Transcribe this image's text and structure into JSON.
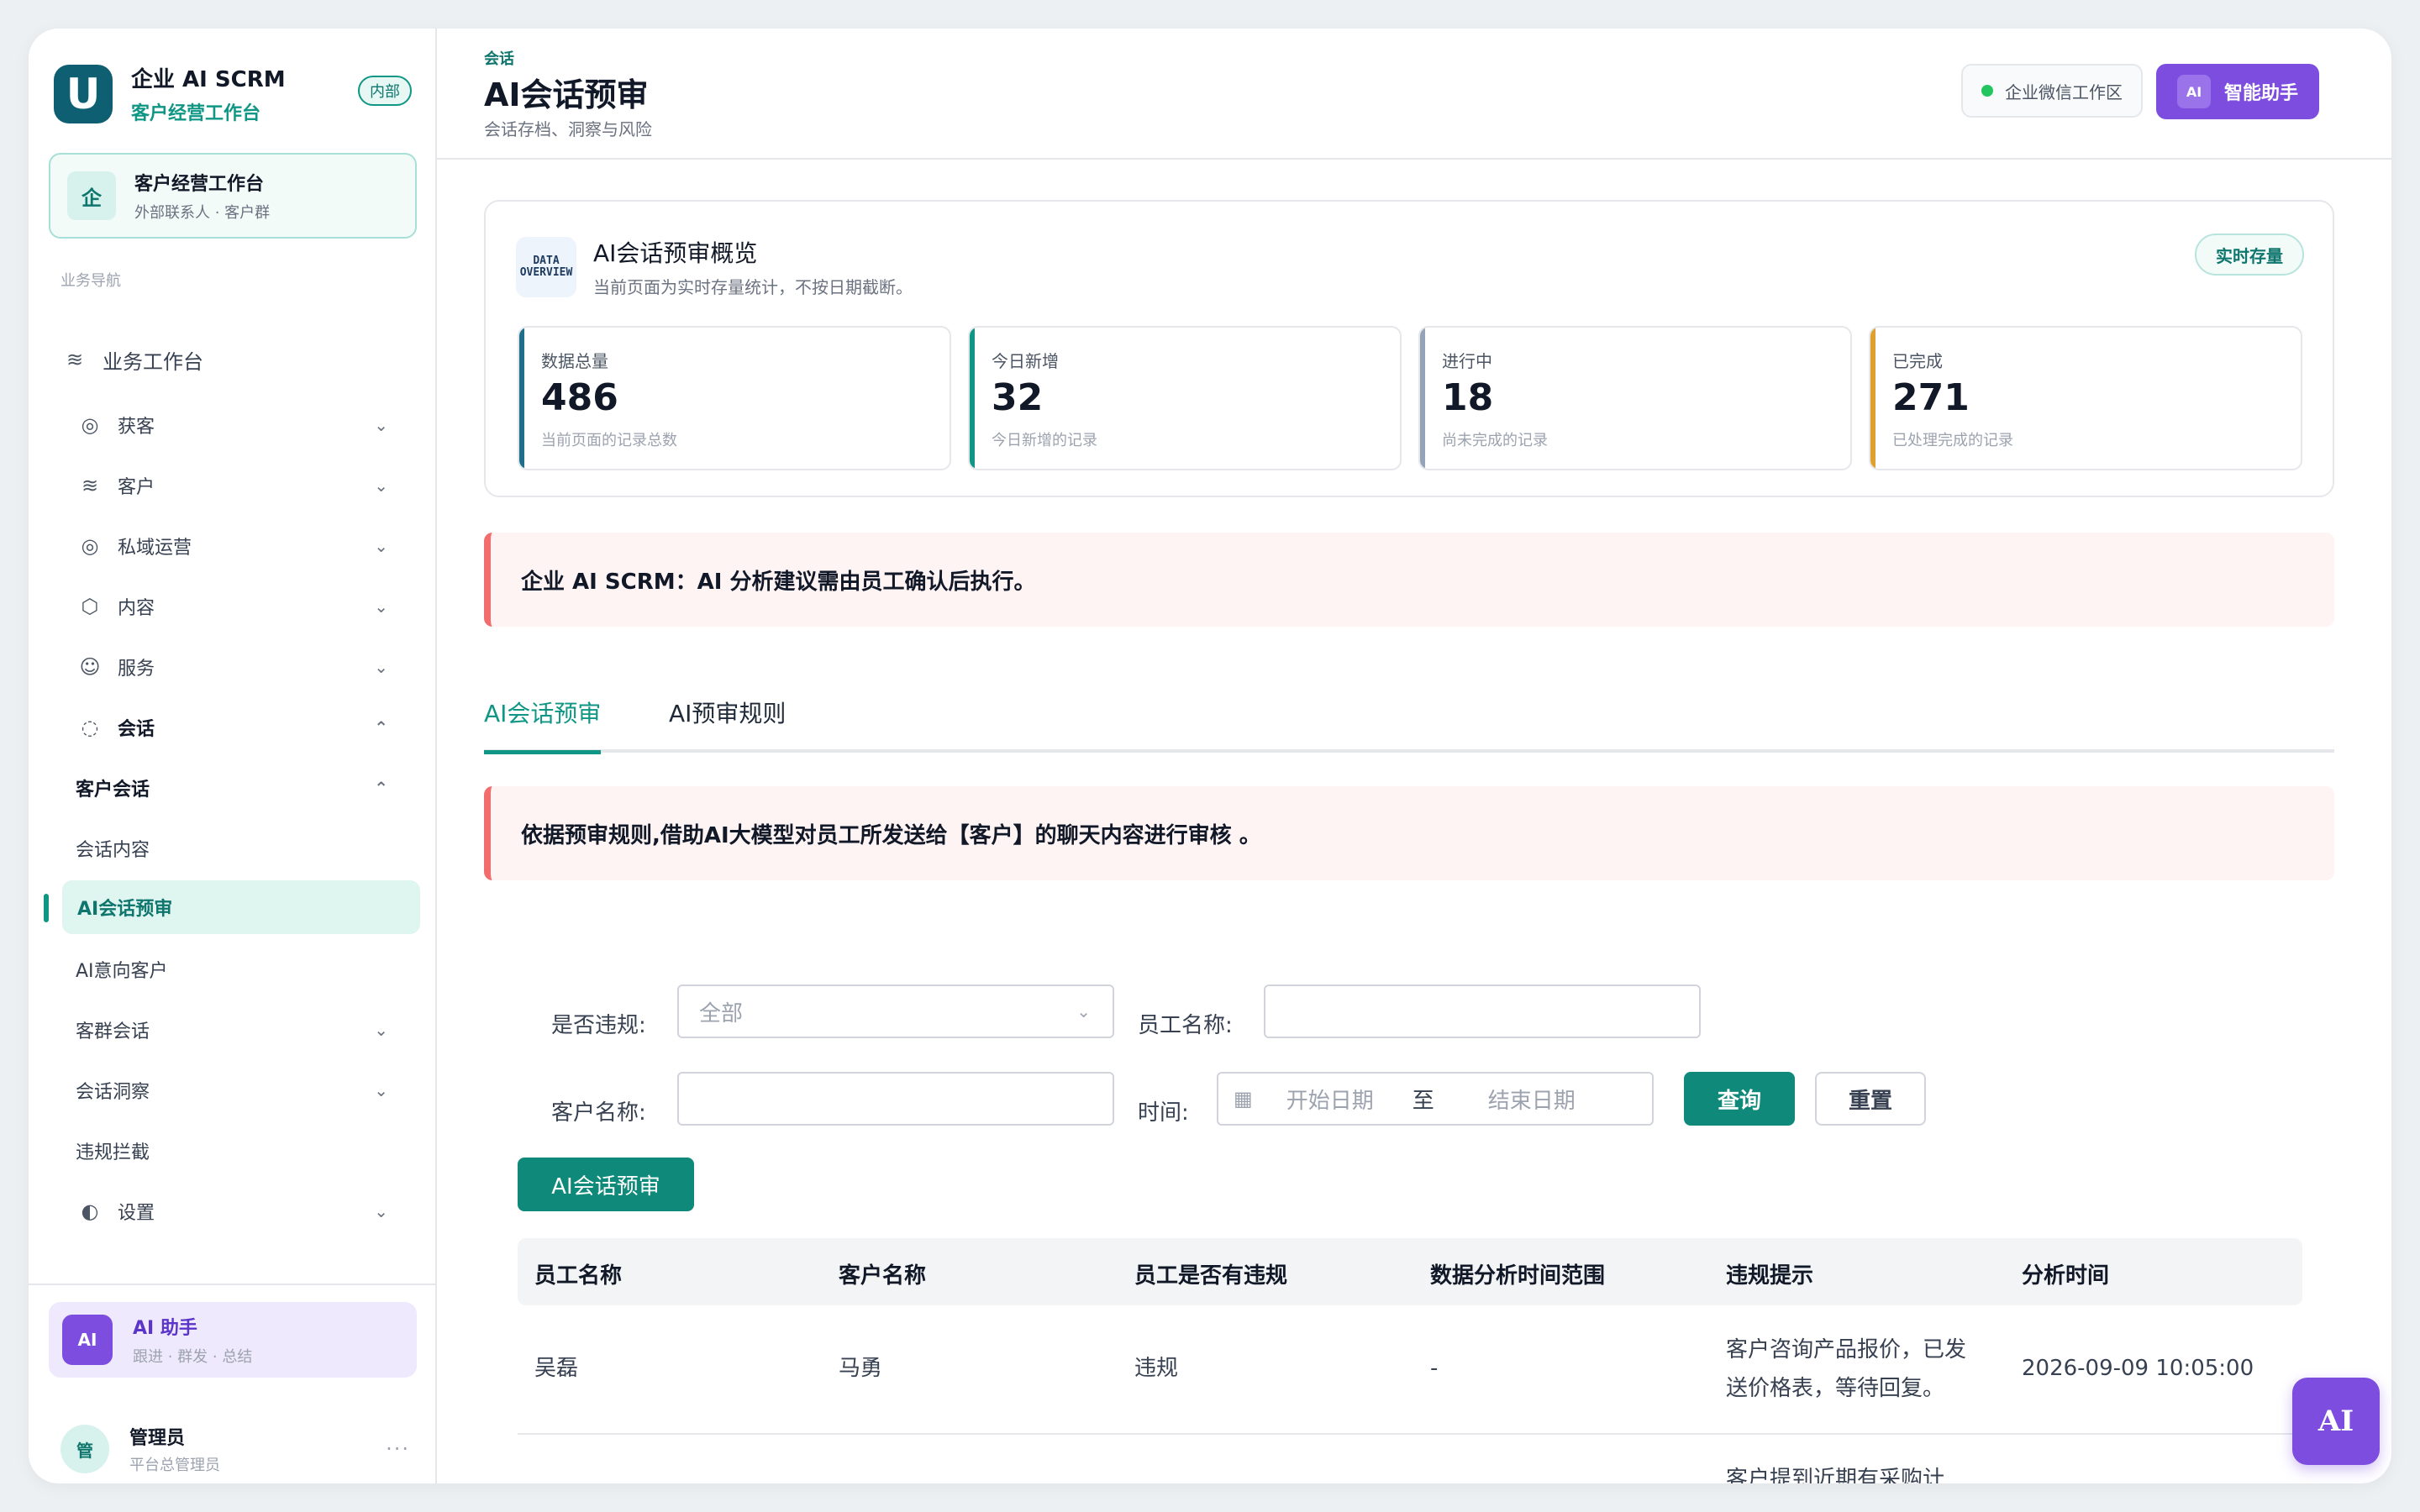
{
  "brand": {
    "title": "企业 AI SCRM",
    "subtitle": "客户经营工作台",
    "badge": "内部",
    "logo": "U"
  },
  "workspace": {
    "icon": "企",
    "title": "客户经营工作台",
    "subtitle": "外部联系人 · 客户群"
  },
  "nav": {
    "section": "业务导航",
    "top": "业务工作台",
    "items": [
      {
        "label": "获客"
      },
      {
        "label": "客户"
      },
      {
        "label": "私域运营"
      },
      {
        "label": "内容"
      },
      {
        "label": "服务"
      },
      {
        "label": "会话"
      },
      {
        "label": "客户会话"
      },
      {
        "label": "会话内容"
      },
      {
        "label": "AI会话预审"
      },
      {
        "label": "AI意向客户"
      },
      {
        "label": "客群会话"
      },
      {
        "label": "会话洞察"
      },
      {
        "label": "违规拦截"
      },
      {
        "label": "设置"
      }
    ]
  },
  "assistant_card": {
    "badge": "AI",
    "title": "AI 助手",
    "subtitle": "跟进 · 群发 · 总结"
  },
  "user": {
    "avatar": "管",
    "name": "管理员",
    "role": "平台总管理员",
    "more": "···"
  },
  "header": {
    "crumb": "会话",
    "title": "AI会话预审",
    "subtitle": "会话存档、洞察与风险",
    "wecom_label": "企业微信工作区",
    "assistant_mini": "AI",
    "assistant_label": "智能助手"
  },
  "overview": {
    "icon_line1": "DATA",
    "icon_line2": "OVERVIEW",
    "title": "AI会话预审概览",
    "subtitle": "当前页面为实时存量统计，不按日期截断。",
    "tag": "实时存量",
    "stats": [
      {
        "label": "数据总量",
        "value": "486",
        "note": "当前页面的记录总数",
        "color": "#1f6f8b"
      },
      {
        "label": "今日新增",
        "value": "32",
        "note": "今日新增的记录",
        "color": "#0f9684"
      },
      {
        "label": "进行中",
        "value": "18",
        "note": "尚未完成的记录",
        "color": "#94a3b8"
      },
      {
        "label": "已完成",
        "value": "271",
        "note": "已处理完成的记录",
        "color": "#e0a030"
      }
    ]
  },
  "alert1": "企业 AI SCRM：AI 分析建议需由员工确认后执行。",
  "tabs": [
    {
      "label": "AI会话预审"
    },
    {
      "label": "AI预审规则"
    }
  ],
  "alert2": "依据预审规则,借助AI大模型对员工所发送给【客户】的聊天内容进行审核 。",
  "filters": {
    "violation_label": "是否违规:",
    "violation_value": "全部",
    "employee_label": "员工名称:",
    "employee_value": "",
    "customer_label": "客户名称:",
    "customer_value": "",
    "time_label": "时间:",
    "start_placeholder": "开始日期",
    "range_sep": "至",
    "end_placeholder": "结束日期",
    "query_button": "查询",
    "reset_button": "重置",
    "action_button": "AI会话预审"
  },
  "table": {
    "headers": [
      "员工名称",
      "客户名称",
      "员工是否有违规",
      "数据分析时间范围",
      "违规提示",
      "分析时间"
    ],
    "rows": [
      {
        "employee": "吴磊",
        "customer": "马勇",
        "violation": "违规",
        "range": "-",
        "hint_line1": "客户咨询产品报价，已发",
        "hint_line2": "送价格表，等待回复。",
        "time": "2026-09-09 10:05:00"
      },
      {
        "hint_line1": "客户提到近期有采购计"
      }
    ]
  },
  "fab": "AI"
}
